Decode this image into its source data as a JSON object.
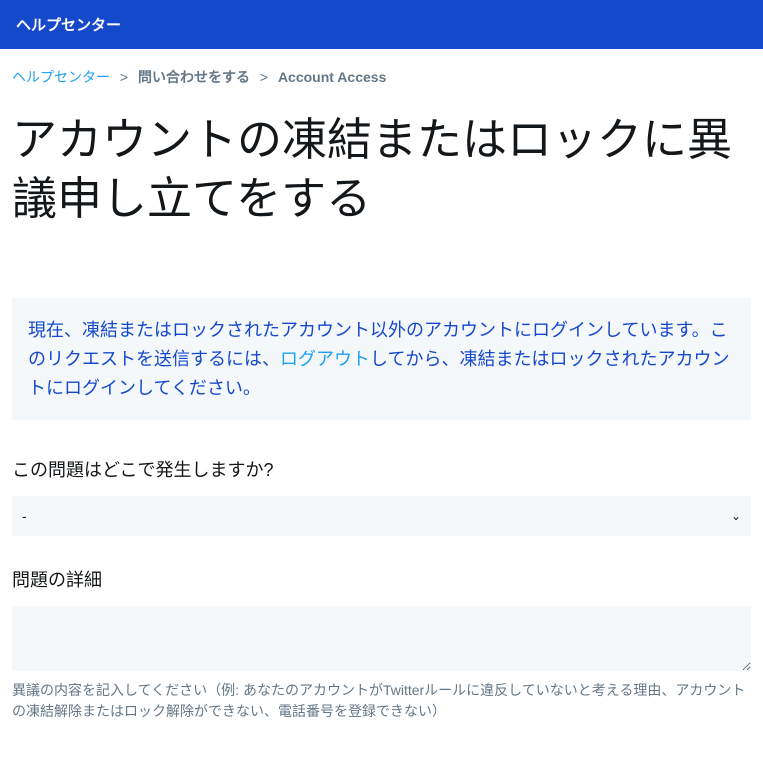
{
  "header": {
    "title": "ヘルプセンター"
  },
  "breadcrumb": {
    "items": [
      {
        "label": "ヘルプセンター",
        "link": true
      },
      {
        "label": "問い合わせをする",
        "link": false
      },
      {
        "label": "Account Access",
        "link": false
      }
    ],
    "separator": ">"
  },
  "page": {
    "title": "アカウントの凍結またはロックに異議申し立てをする"
  },
  "notice": {
    "text_before": "現在、凍結またはロックされたアカウント以外のアカウントにログインしています。このリクエストを送信するには、",
    "link_text": "ログアウト",
    "text_after": "してから、凍結またはロックされたアカウントにログインしてください。"
  },
  "form": {
    "location": {
      "label": "この問題はどこで発生しますか?",
      "selected": "-"
    },
    "details": {
      "label": "問題の詳細",
      "value": "",
      "help": "異議の内容を記入してください（例: あなたのアカウントがTwitterルールに違反していないと考える理由、アカウントの凍結解除またはロック解除ができない、電話番号を登録できない）"
    }
  }
}
